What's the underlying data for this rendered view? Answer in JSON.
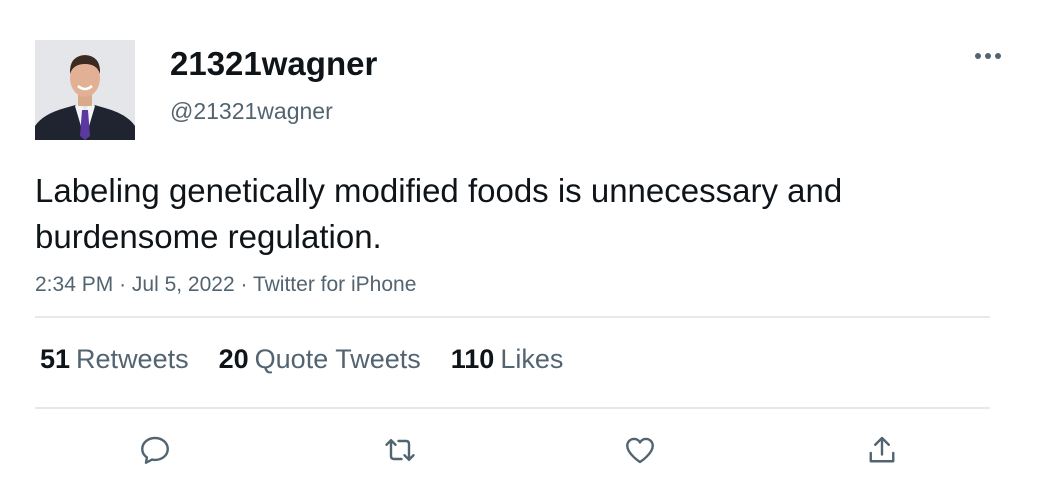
{
  "user": {
    "display_name": "21321wagner",
    "handle": "@21321wagner"
  },
  "tweet": {
    "text": "Labeling genetically modified foods is unnecessary and burdensome regulation.",
    "time": "2:34 PM",
    "separator": "·",
    "date": "Jul 5, 2022",
    "source": "Twitter for iPhone"
  },
  "stats": {
    "retweets": {
      "count": "51",
      "label": "Retweets"
    },
    "quote_tweets": {
      "count": "20",
      "label": "Quote Tweets"
    },
    "likes": {
      "count": "110",
      "label": "Likes"
    }
  },
  "icons": {
    "more": "more-horizontal-icon",
    "reply": "reply-icon",
    "retweet": "retweet-icon",
    "like": "like-icon",
    "share": "share-icon"
  },
  "colors": {
    "text_primary": "#0f1419",
    "text_secondary": "#536471",
    "divider": "#e6e9eb",
    "icon": "#536471"
  }
}
